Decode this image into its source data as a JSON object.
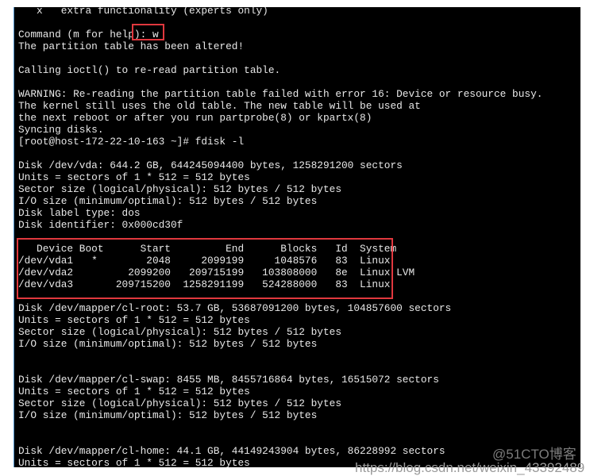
{
  "terminal": {
    "lines": [
      "   x   extra functionality (experts only)",
      "",
      "Command (m for help): w",
      "The partition table has been altered!",
      "",
      "Calling ioctl() to re-read partition table.",
      "",
      "WARNING: Re-reading the partition table failed with error 16: Device or resource busy.",
      "The kernel still uses the old table. The new table will be used at",
      "the next reboot or after you run partprobe(8) or kpartx(8)",
      "Syncing disks.",
      "[root@host-172-22-10-163 ~]# fdisk -l",
      "",
      "Disk /dev/vda: 644.2 GB, 644245094400 bytes, 1258291200 sectors",
      "Units = sectors of 1 * 512 = 512 bytes",
      "Sector size (logical/physical): 512 bytes / 512 bytes",
      "I/O size (minimum/optimal): 512 bytes / 512 bytes",
      "Disk label type: dos",
      "Disk identifier: 0x000cd30f",
      "",
      "   Device Boot      Start         End      Blocks   Id  System",
      "/dev/vda1   *        2048     2099199     1048576   83  Linux",
      "/dev/vda2         2099200   209715199   103808000   8e  Linux LVM",
      "/dev/vda3       209715200  1258291199   524288000   83  Linux",
      "",
      "Disk /dev/mapper/cl-root: 53.7 GB, 53687091200 bytes, 104857600 sectors",
      "Units = sectors of 1 * 512 = 512 bytes",
      "Sector size (logical/physical): 512 bytes / 512 bytes",
      "I/O size (minimum/optimal): 512 bytes / 512 bytes",
      "",
      "",
      "Disk /dev/mapper/cl-swap: 8455 MB, 8455716864 bytes, 16515072 sectors",
      "Units = sectors of 1 * 512 = 512 bytes",
      "Sector size (logical/physical): 512 bytes / 512 bytes",
      "I/O size (minimum/optimal): 512 bytes / 512 bytes",
      "",
      "",
      "Disk /dev/mapper/cl-home: 44.1 GB, 44149243904 bytes, 86228992 sectors",
      "Units = sectors of 1 * 512 = 512 bytes"
    ]
  },
  "watermark": {
    "site": "@51CTO博客",
    "url": "https://blog.csdn.net/weixin_43392489"
  },
  "colors": {
    "background": "#000000",
    "text": "#e8e8e8",
    "highlight": "#e0383e"
  }
}
